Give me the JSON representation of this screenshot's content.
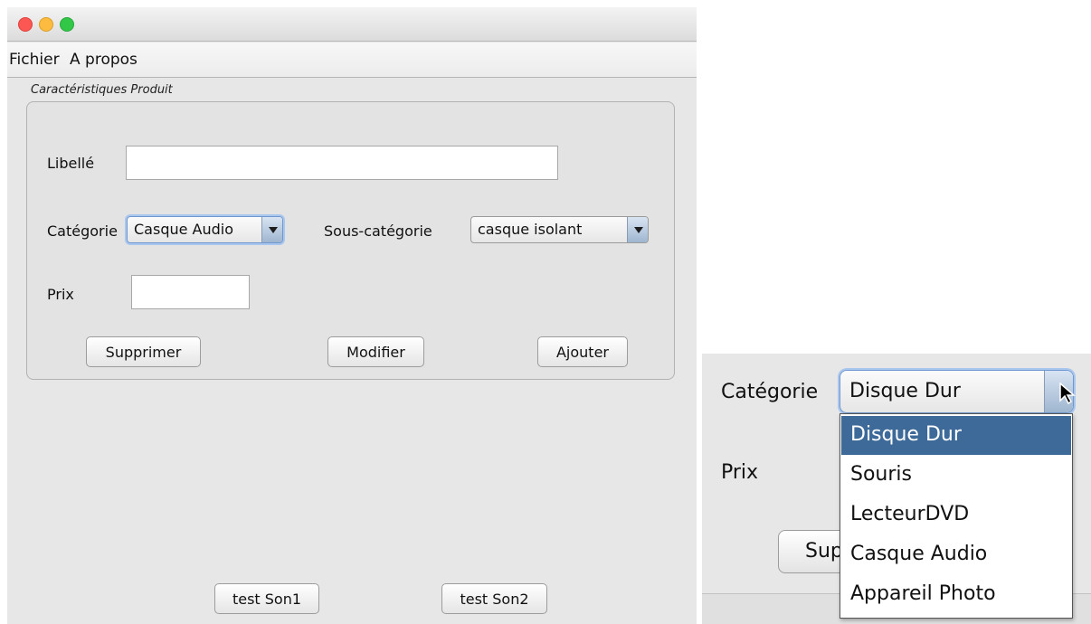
{
  "menu": {
    "items": [
      "Fichier",
      "A propos"
    ]
  },
  "form": {
    "group_title": "Caractéristiques Produit",
    "libelle_label": "Libellé",
    "libelle_value": "",
    "categorie_label": "Catégorie",
    "categorie_value": "Casque Audio",
    "sous_categorie_label": "Sous-catégorie",
    "sous_categorie_value": "casque isolant",
    "prix_label": "Prix",
    "prix_value": "",
    "buttons": {
      "delete": "Supprimer",
      "modify": "Modifier",
      "add": "Ajouter"
    }
  },
  "bottom_buttons": {
    "test1": "test Son1",
    "test2": "test Son2"
  },
  "inset": {
    "categorie_label": "Catégorie",
    "categorie_value": "Disque Dur",
    "prix_label": "Prix",
    "button_partial": "Sup",
    "options": [
      "Disque Dur",
      "Souris",
      "LecteurDVD",
      "Casque Audio",
      "Appareil Photo"
    ],
    "selected_option": "Disque Dur"
  },
  "colors": {
    "selection": "#3d6a98",
    "focus_ring": "#a9c6ee",
    "close": "#fc5753",
    "minimize": "#fdbc40",
    "zoom": "#33c748"
  }
}
